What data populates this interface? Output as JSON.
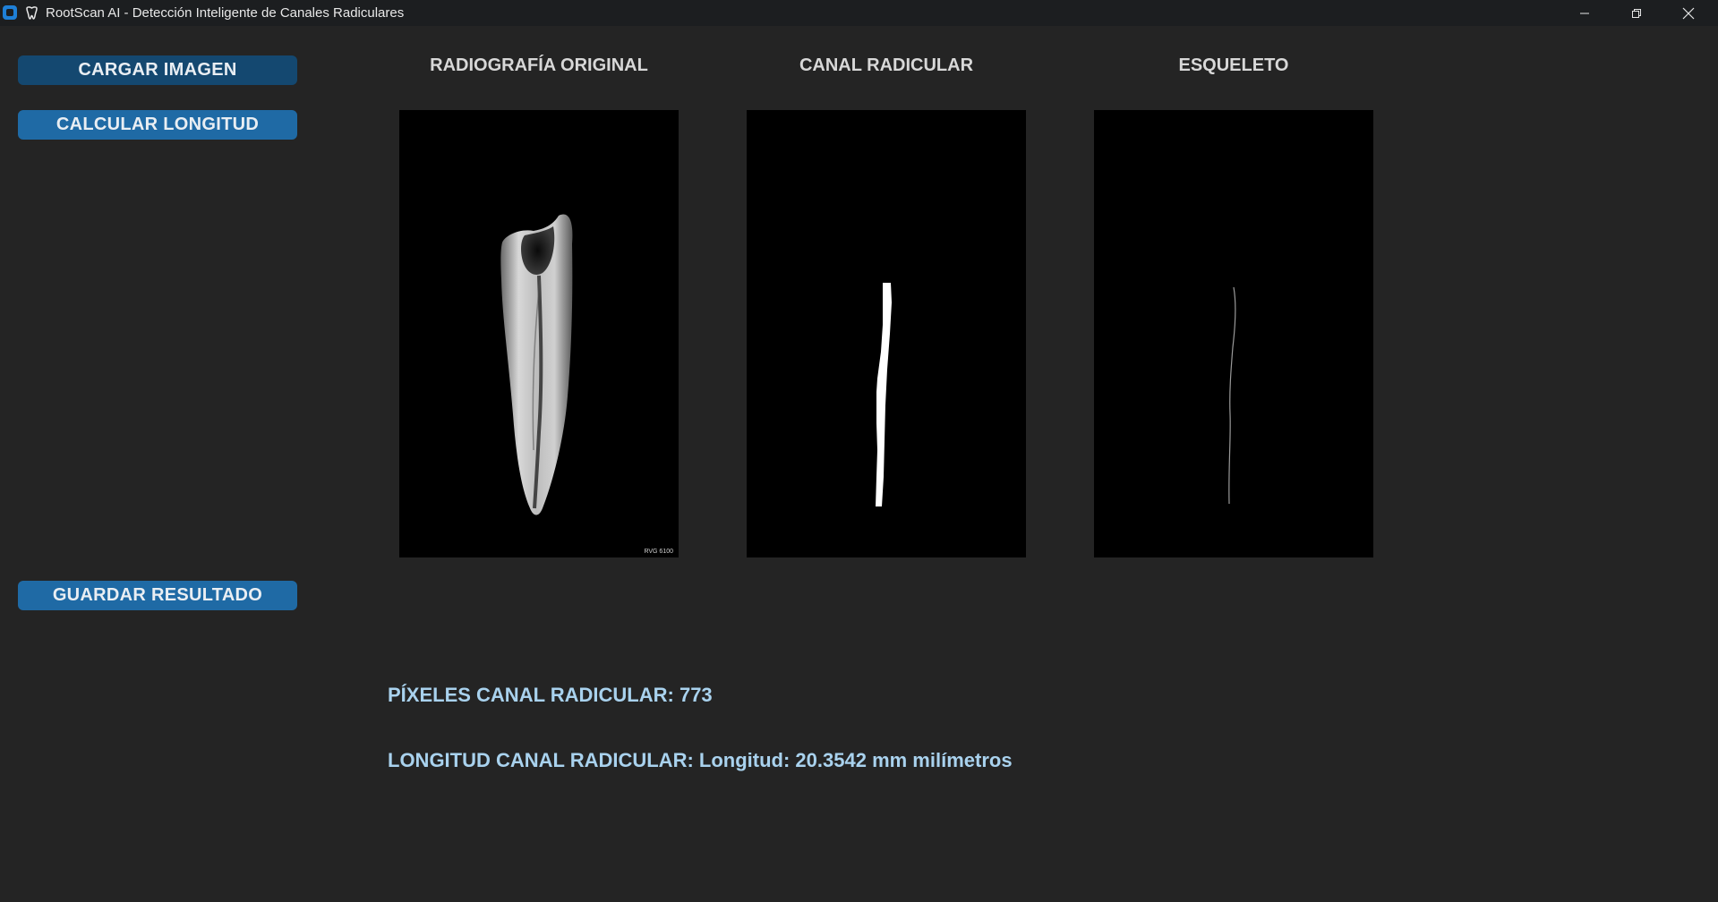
{
  "window": {
    "title": "RootScan AI - Detección Inteligente de Canales Radiculares",
    "controls": [
      "minimize-icon",
      "restore-icon",
      "close-icon"
    ]
  },
  "sidebar": {
    "load_button": "CARGAR IMAGEN",
    "calc_button": "CALCULAR LONGITUD",
    "save_button": "GUARDAR RESULTADO"
  },
  "panels": {
    "original": {
      "title": "RADIOGRAFÍA ORIGINAL",
      "watermark": "RVG 6100"
    },
    "canal": {
      "title": "CANAL RADICULAR"
    },
    "skeleton": {
      "title": "ESQUELETO"
    }
  },
  "results": {
    "pixels_label": "PÍXELES CANAL RADICULAR:",
    "pixels_value": "773",
    "length_label": "LONGITUD CANAL RADICULAR:",
    "length_value": "Longitud: 20.3542 mm milímetros"
  },
  "colors": {
    "background": "#242424",
    "titlebar": "#1c1e20",
    "button": "#1f6aa5",
    "button_hover": "#144870",
    "panel_title": "#d8d8d8",
    "result_text": "#a9d2ee"
  }
}
